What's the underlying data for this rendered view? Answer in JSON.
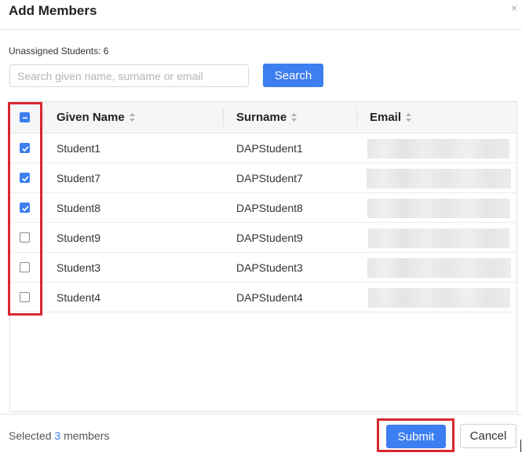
{
  "dialog": {
    "title": "Add Members",
    "close_symbol": "×"
  },
  "filter": {
    "unassigned_label": "Unassigned Students: 6",
    "search_placeholder": "Search given name, surname or email",
    "search_value": "",
    "search_button": "Search"
  },
  "table": {
    "columns": [
      {
        "label": "Given Name",
        "sortable": true
      },
      {
        "label": "Surname",
        "sortable": true
      },
      {
        "label": "Email",
        "sortable": true
      }
    ],
    "select_all_state": "indeterminate",
    "rows": [
      {
        "given_name": "Student1",
        "surname": "DAPStudent1",
        "email_redacted": true,
        "checked": true
      },
      {
        "given_name": "Student7",
        "surname": "DAPStudent7",
        "email_redacted": true,
        "checked": true
      },
      {
        "given_name": "Student8",
        "surname": "DAPStudent8",
        "email_redacted": true,
        "checked": true
      },
      {
        "given_name": "Student9",
        "surname": "DAPStudent9",
        "email_redacted": true,
        "checked": false
      },
      {
        "given_name": "Student3",
        "surname": "DAPStudent3",
        "email_redacted": true,
        "checked": false
      },
      {
        "given_name": "Student4",
        "surname": "DAPStudent4",
        "email_redacted": true,
        "checked": false
      }
    ]
  },
  "footer": {
    "selected_prefix": "Selected",
    "selected_count": "3",
    "selected_suffix": "members",
    "submit_label": "Submit",
    "cancel_label": "Cancel"
  },
  "icons": {
    "sort": "sort-icon",
    "checkbox_checked": "check-icon",
    "checkbox_indeterminate": "minus-icon",
    "close": "close-icon"
  },
  "colors": {
    "primary": "#3d7ef0",
    "highlight": "#d9262f",
    "header_bg": "#f5f6f8"
  }
}
